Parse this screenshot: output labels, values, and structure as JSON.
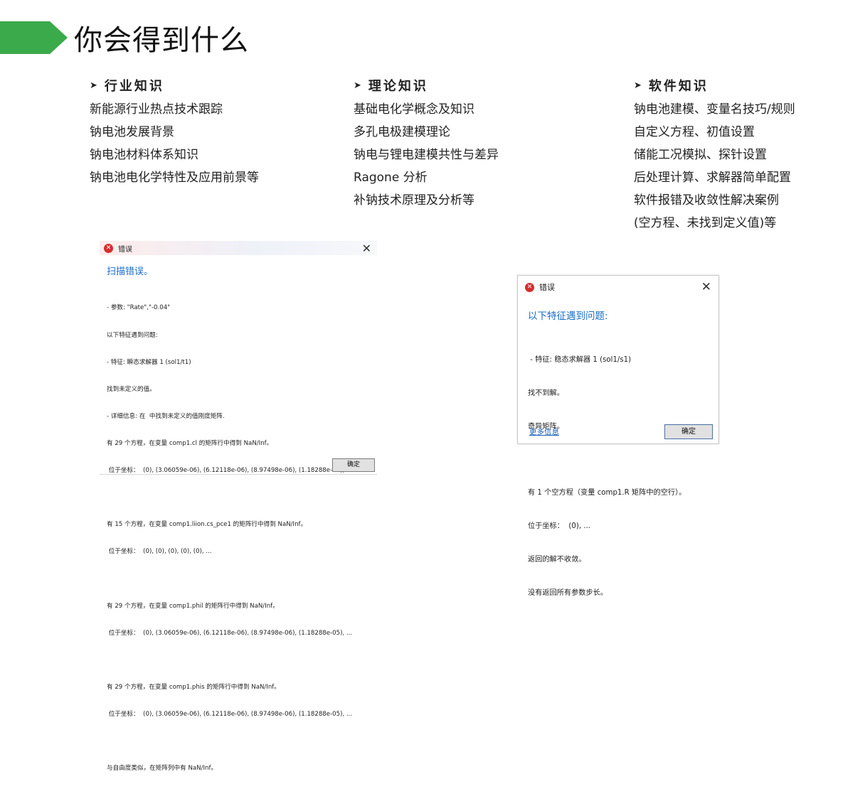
{
  "colors": {
    "accent_green": "#3aaa4a",
    "error_red": "#d32f2f",
    "link_blue": "#1a6ec8"
  },
  "page": {
    "title": "你会得到什么"
  },
  "columns": [
    {
      "heading": "行业知识",
      "items": [
        "新能源行业热点技术跟踪",
        "钠电池发展背景",
        "钠电池材料体系知识",
        "钠电池电化学特性及应用前景等"
      ]
    },
    {
      "heading": "理论知识",
      "items": [
        "基础电化学概念及知识",
        "多孔电极建模理论",
        "钠电与锂电建模共性与差异",
        "Ragone 分析",
        "补钠技术原理及分析等"
      ]
    },
    {
      "heading": "软件知识",
      "items": [
        "钠电池建模、变量名技巧/规则",
        "自定义方程、初值设置",
        "储能工况模拟、探针设置",
        "后处理计算、求解器简单配置",
        "软件报错及收敛性解决案例",
        "(空方程、未找到定义值)等"
      ]
    }
  ],
  "dialog1": {
    "title": "错误",
    "icon": "error-icon",
    "main_message": "扫描错误。",
    "details": [
      "- 参数: \"Rate\",\"-0.04\"",
      "以下特征遇到问题:",
      "- 特征: 瞬态求解器 1 (sol1/t1)",
      "找到未定义的值。",
      "- 详细信息: 在  中找到未定义的值刚度矩阵.",
      "有 29 个方程，在变量 comp1.cl 的矩阵行中得到 NaN/Inf。",
      " 位于坐标：  (0), (3.06059e-06), (6.12118e-06), (8.97498e-06), (1.18288e-05), ...",
      "",
      "有 15 个方程，在变量 comp1.liion.cs_pce1 的矩阵行中得到 NaN/Inf。",
      " 位于坐标：  (0), (0), (0), (0), (0), ...",
      "",
      "有 29 个方程，在变量 comp1.phil 的矩阵行中得到 NaN/Inf。",
      " 位于坐标：  (0), (3.06059e-06), (6.12118e-06), (8.97498e-06), (1.18288e-05), ...",
      "",
      "有 29 个方程，在变量 comp1.phis 的矩阵行中得到 NaN/Inf。",
      " 位于坐标：  (0), (3.06059e-06), (6.12118e-06), (8.97498e-06), (1.18288e-05), ...",
      "",
      "与自由度类似，在矩阵列中有 NaN/Inf。"
    ],
    "ok_label": "确定"
  },
  "dialog2": {
    "title": "错误",
    "icon": "error-icon",
    "main_message": "以下特征遇到问题:",
    "details": [
      " - 特征: 稳态求解器 1 (sol1/s1)",
      "找不到解。",
      "奇异矩阵。",
      "",
      "有 1 个空方程（变量 comp1.R 矩阵中的空行）。",
      "位于坐标：  (0), ...",
      "返回的解不收敛。",
      "没有返回所有参数步长。"
    ],
    "more_info_label": "更多信息",
    "ok_label": "确定"
  }
}
